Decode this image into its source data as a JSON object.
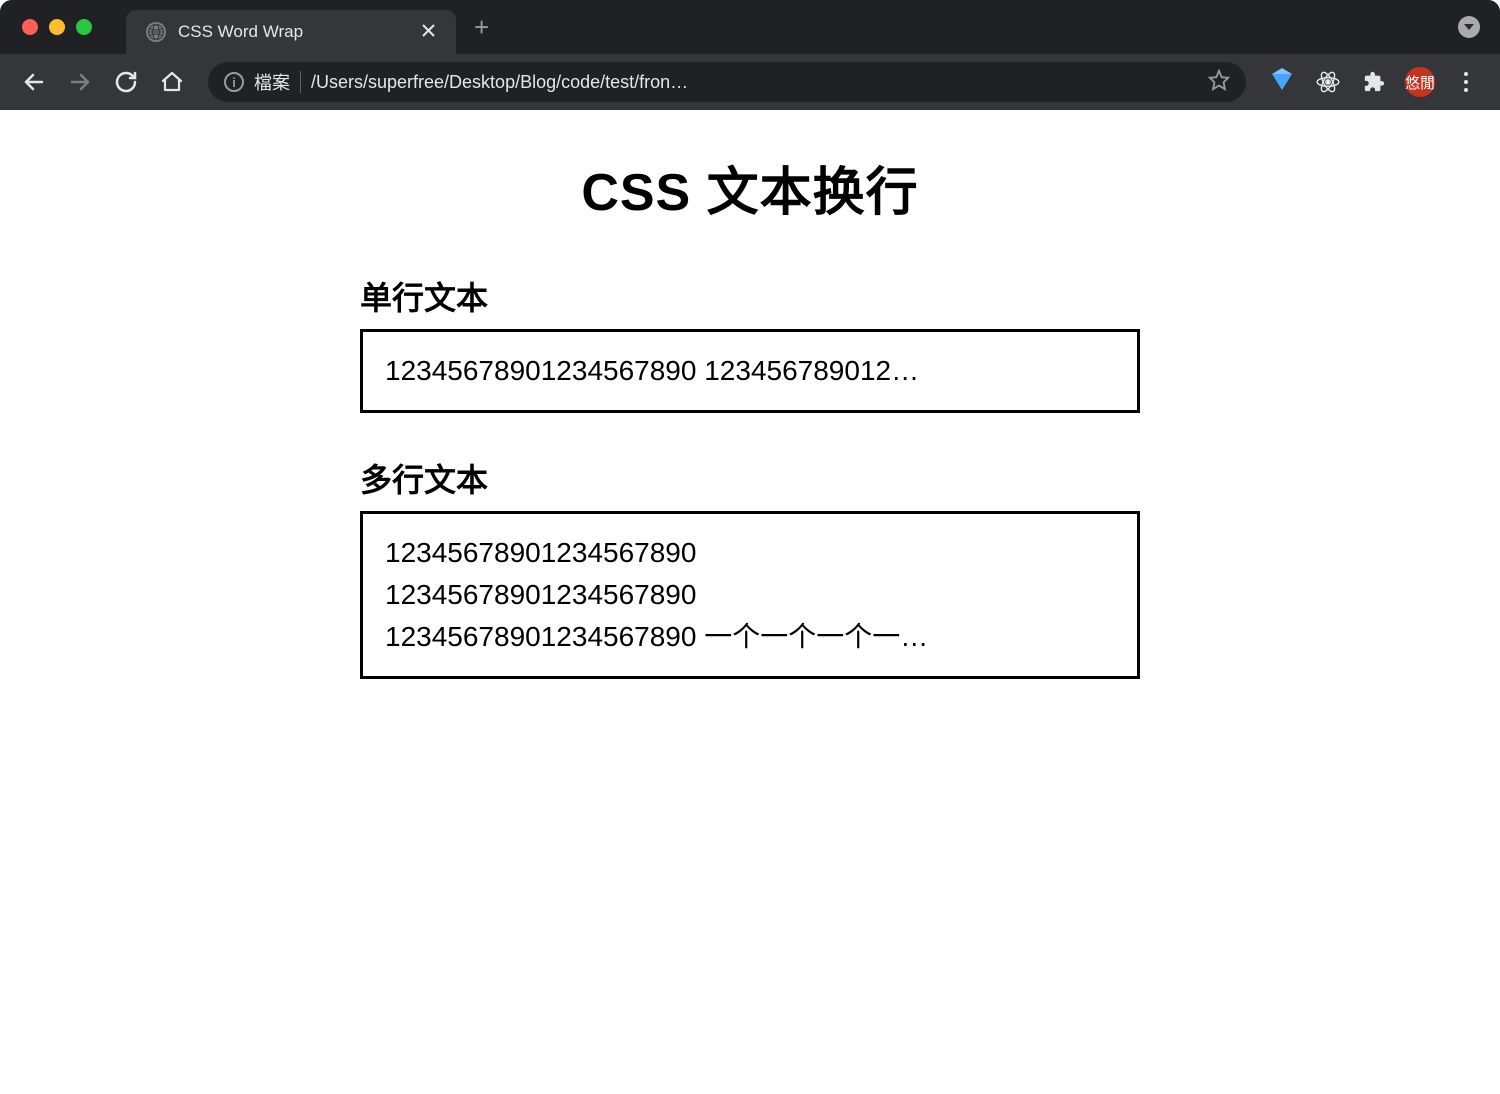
{
  "browser": {
    "tab_title": "CSS Word Wrap",
    "url_prefix": "檔案",
    "url_path": "/Users/superfree/Desktop/Blog/code/test/fron…",
    "avatar_text": "悠閒"
  },
  "page": {
    "title": "CSS 文本换行",
    "section1": {
      "heading": "单行文本",
      "content": "12345678901234567890 123456789012…"
    },
    "section2": {
      "heading": "多行文本",
      "content": "12345678901234567890\n12345678901234567890\n12345678901234567890 一个一个一个一…"
    }
  }
}
